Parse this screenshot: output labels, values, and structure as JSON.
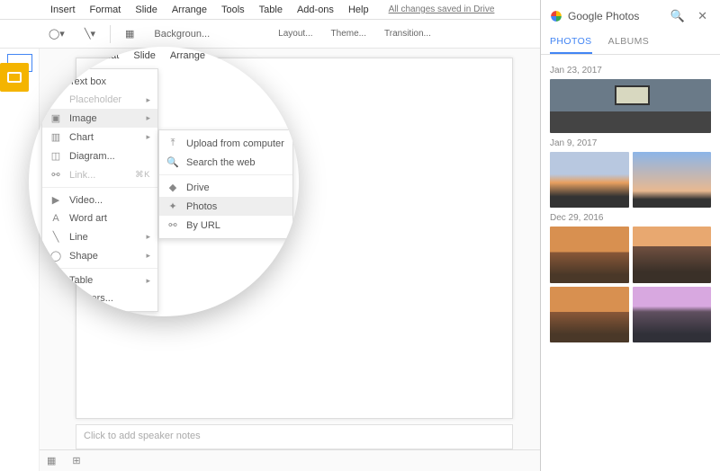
{
  "menubar": {
    "items": [
      "Insert",
      "Format",
      "Slide",
      "Arrange",
      "Tools",
      "Table",
      "Add-ons",
      "Help"
    ],
    "saved_text": "All changes saved in Drive"
  },
  "toolbar": {
    "background": "Backgroun...",
    "secondary": {
      "layout": "Layout...",
      "theme": "Theme...",
      "transition": "Transition..."
    }
  },
  "notes_placeholder": "Click to add speaker notes",
  "insert_menu": {
    "items": [
      {
        "icon": "textbox-icon",
        "glyph": "T",
        "label": "Text box",
        "disabled": false,
        "submenu": false
      },
      {
        "icon": "placeholder-icon",
        "glyph": "",
        "label": "Placeholder",
        "disabled": true,
        "submenu": true
      },
      {
        "icon": "image-icon",
        "glyph": "▣",
        "label": "Image",
        "disabled": false,
        "submenu": true,
        "highlight": true
      },
      {
        "icon": "chart-icon",
        "glyph": "▥",
        "label": "Chart",
        "disabled": false,
        "submenu": true
      },
      {
        "icon": "diagram-icon",
        "glyph": "◫",
        "label": "Diagram...",
        "disabled": false,
        "submenu": false
      },
      {
        "icon": "link-icon",
        "glyph": "⚯",
        "label": "Link...",
        "disabled": true,
        "submenu": false,
        "shortcut": "⌘K"
      },
      {
        "icon": "video-icon",
        "glyph": "▶",
        "label": "Video...",
        "disabled": false,
        "submenu": false
      },
      {
        "icon": "wordart-icon",
        "glyph": "A",
        "label": "Word art",
        "disabled": false,
        "submenu": false
      },
      {
        "icon": "line-icon",
        "glyph": "╲",
        "label": "Line",
        "disabled": false,
        "submenu": true
      },
      {
        "icon": "shape-icon",
        "glyph": "◯",
        "label": "Shape",
        "disabled": false,
        "submenu": true
      },
      {
        "icon": "table-icon",
        "glyph": "",
        "label": "Table",
        "disabled": false,
        "submenu": true
      },
      {
        "icon": "numbers-icon",
        "glyph": "",
        "label": "...mbers...",
        "disabled": false,
        "submenu": false
      }
    ]
  },
  "image_submenu": {
    "items": [
      {
        "icon": "upload-icon",
        "glyph": "⤒",
        "label": "Upload from computer"
      },
      {
        "icon": "search-icon",
        "glyph": "🔍",
        "label": "Search the web"
      },
      {
        "icon": "drive-icon",
        "glyph": "◆",
        "label": "Drive"
      },
      {
        "icon": "photos-icon",
        "glyph": "✦",
        "label": "Photos",
        "highlight": true
      },
      {
        "icon": "url-icon",
        "glyph": "⚯",
        "label": "By URL"
      }
    ]
  },
  "panel": {
    "title": "Google Photos",
    "tabs": {
      "photos": "PHOTOS",
      "albums": "ALBUMS"
    },
    "groups": [
      {
        "date": "Jan 23, 2017",
        "images": [
          "building"
        ]
      },
      {
        "date": "Jan 9, 2017",
        "images": [
          "sunset",
          "sky"
        ]
      },
      {
        "date": "Dec 29, 2016",
        "images": [
          "city",
          "city2",
          "city",
          "purple"
        ]
      }
    ]
  }
}
